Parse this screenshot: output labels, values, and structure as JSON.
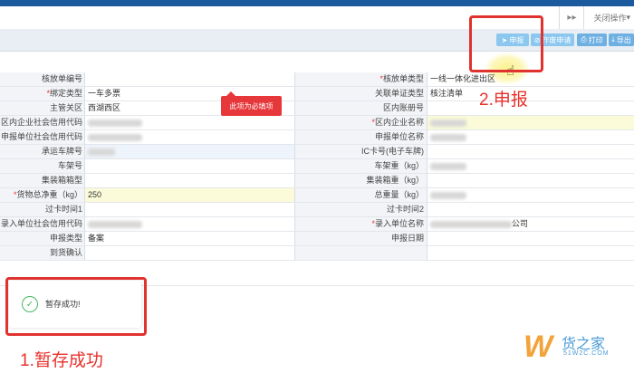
{
  "header": {
    "close_ops_label": "关闭操作",
    "close_ops_arrow": "▾",
    "forward_symbol": "▸▸"
  },
  "toolbar": {
    "declare_label": "申报",
    "cancel_request_label": "作废申请",
    "print_label": "打印",
    "export_label": "导出"
  },
  "form": {
    "rows": [
      {
        "l1": "核放单编号",
        "v1": "",
        "l2": "核放单类型",
        "r2": true,
        "v2": "一线一体化进出区"
      },
      {
        "l1": "绑定类型",
        "r1": true,
        "v1": "一车多票",
        "l2": "关联单证类型",
        "v2": "核注清单"
      },
      {
        "l1": "主管关区",
        "v1": "西湖西区",
        "l2": "区内账册号",
        "v2": ""
      },
      {
        "l1": "区内企业社会信用代码",
        "v1": "",
        "l2": "区内企业名称",
        "r2": true,
        "v2": ""
      },
      {
        "l1": "申报单位社会信用代码",
        "v1": "",
        "l2": "申报单位名称",
        "v2": ""
      },
      {
        "l1": "承运车牌号",
        "v1": "",
        "l2": "IC卡号(电子车牌)",
        "v2": ""
      },
      {
        "l1": "车架号",
        "v1": "",
        "l2": "车架重（kg）",
        "v2": ""
      },
      {
        "l1": "集装箱箱型",
        "v1": "",
        "l2": "集装箱重（kg）",
        "v2": ""
      },
      {
        "l1": "货物总净重（kg）",
        "r1": true,
        "v1": "250",
        "l2": "总重量（kg）",
        "v2": ""
      },
      {
        "l1": "过卡时间1",
        "v1": "",
        "l2": "过卡时间2",
        "v2": ""
      },
      {
        "l1": "录入单位社会信用代码",
        "v1": "",
        "l2": "录入单位名称",
        "r2": true,
        "v2": "公司"
      },
      {
        "l1": "申报类型",
        "v1": "备案",
        "l2": "申报日期",
        "v2": ""
      },
      {
        "l1": "到货确认",
        "v1": "",
        "l2": "",
        "v2": ""
      }
    ]
  },
  "tooltip": {
    "text": "此项为必填项"
  },
  "toast": {
    "text": "暂存成功!",
    "icon": "check-circle-icon"
  },
  "annotations": {
    "step1": "1.暂存成功",
    "step2": "2.申报"
  },
  "watermark": {
    "logo_letter": "W",
    "title": "货之家",
    "url": "51W2C.COM"
  },
  "colors": {
    "accent": "#e0322e",
    "brand_bar": "#1c5a9e",
    "button": "#8bc7ef",
    "success": "#48b95e"
  }
}
